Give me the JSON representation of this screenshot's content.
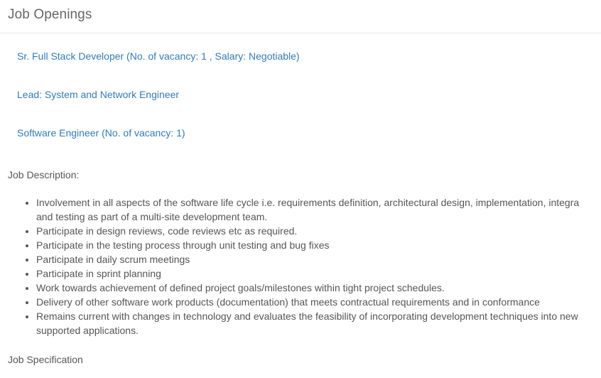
{
  "header": {
    "title": "Job Openings"
  },
  "openings": [
    {
      "label": "Sr. Full Stack Developer (No. of vacancy: 1 , Salary: Negotiable)"
    },
    {
      "label": "Lead: System and Network Engineer"
    },
    {
      "label": "Software Engineer (No. of vacancy: 1)"
    }
  ],
  "job_description": {
    "label": "Job Description:",
    "items": [
      {
        "line1": "Involvement in all aspects of the software life cycle i.e. requirements definition, architectural design, implementation, integra",
        "line2": "and testing as part of a multi-site development team."
      },
      {
        "line1": "Participate in design reviews, code reviews etc as required."
      },
      {
        "line1": "Participate in the testing process through unit testing and bug fixes"
      },
      {
        "line1": "Participate in daily scrum meetings"
      },
      {
        "line1": "Participate in sprint planning"
      },
      {
        "line1": "Work towards achievement of defined project goals/milestones within tight project schedules."
      },
      {
        "line1": "Delivery of other software work products (documentation) that meets contractual requirements and in conformance"
      },
      {
        "line1": "Remains current with changes in technology and evaluates the feasibility of incorporating development techniques into new",
        "line2": "supported applications."
      }
    ]
  },
  "job_specification": {
    "label": "Job Specification"
  },
  "colors": {
    "link": "#337ab7",
    "text": "#555555",
    "divider": "#e5e5e5"
  }
}
